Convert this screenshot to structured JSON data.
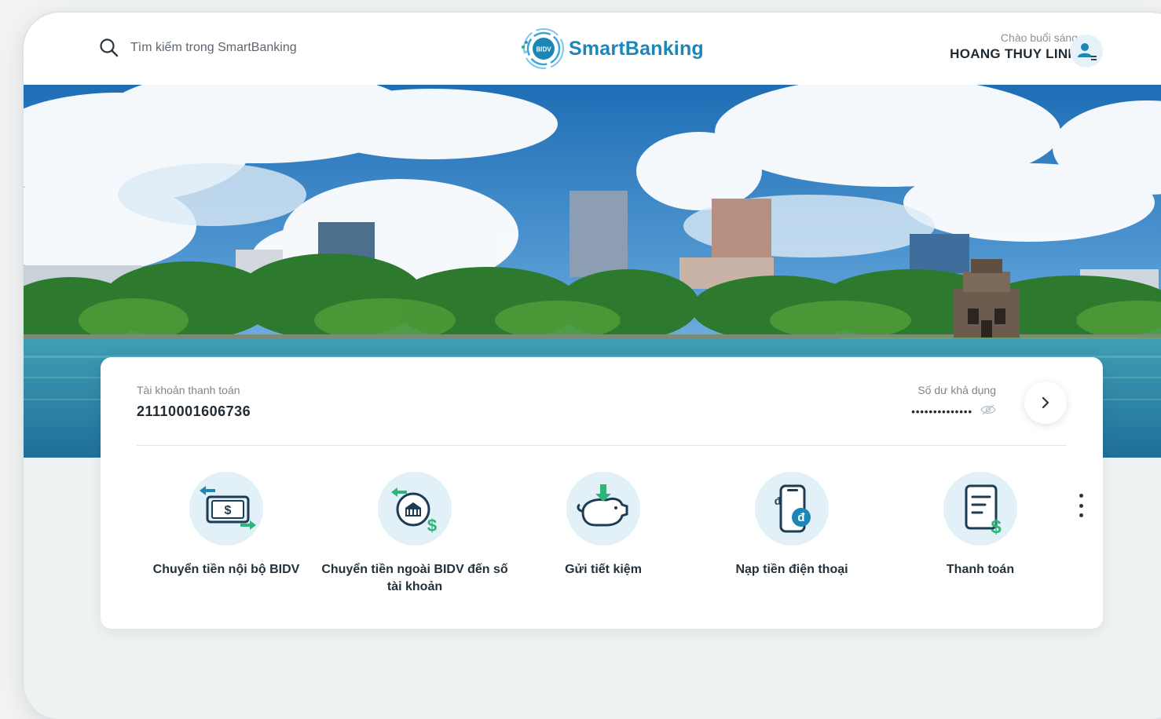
{
  "header": {
    "search_placeholder": "Tìm kiếm trong SmartBanking",
    "logo_badge": "BIDV",
    "logo_text": "SmartBanking",
    "greeting": "Chào buổi sáng",
    "user_name": "HOANG THUY LINH"
  },
  "account": {
    "label": "Tài khoản thanh toán",
    "number": "21110001606736",
    "balance_label": "Số dư khả dụng",
    "balance_masked": "••••••••••••••"
  },
  "actions": [
    {
      "label": "Chuyển tiền nội bộ BIDV",
      "icon": "internal-transfer-icon"
    },
    {
      "label": "Chuyển tiền ngoài BIDV đến số tài khoản",
      "icon": "external-transfer-icon"
    },
    {
      "label": "Gửi tiết kiệm",
      "icon": "savings-piggy-icon"
    },
    {
      "label": "Nạp tiền điện thoại",
      "icon": "phone-topup-icon"
    },
    {
      "label": "Thanh toán",
      "icon": "bill-payment-icon"
    }
  ],
  "colors": {
    "brand": "#1d86b7",
    "accent_green": "#2bb57a",
    "icon_bg": "#e2f0f7"
  }
}
